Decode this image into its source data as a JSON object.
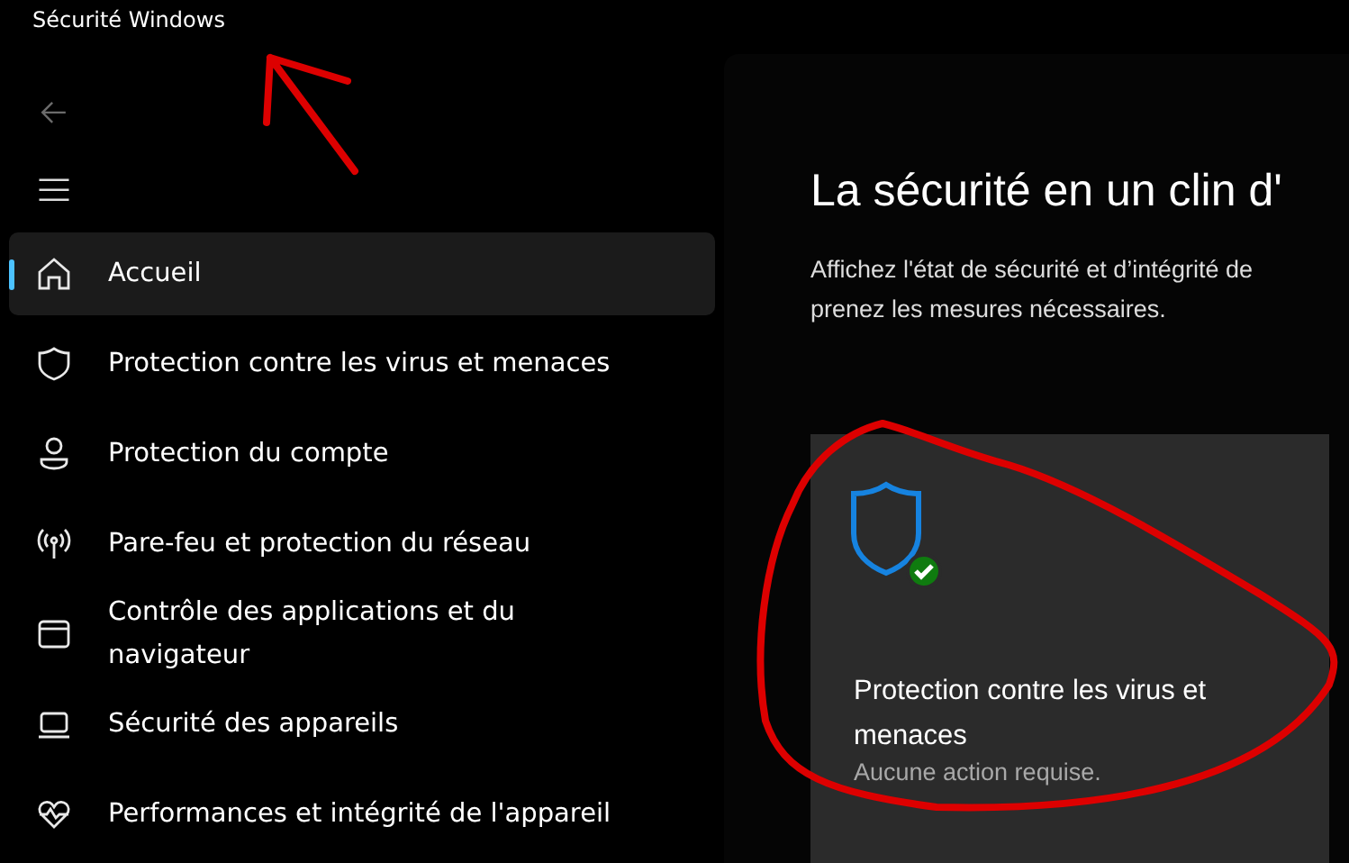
{
  "window": {
    "title": "Sécurité Windows"
  },
  "sidebar": {
    "items": [
      {
        "label": "Accueil",
        "kind": "home",
        "selected": true
      },
      {
        "label": "Protection contre les virus et menaces",
        "kind": "shield",
        "selected": false
      },
      {
        "label": "Protection du compte",
        "kind": "person",
        "selected": false
      },
      {
        "label": "Pare-feu et protection du réseau",
        "kind": "antenna",
        "selected": false
      },
      {
        "label": "Contrôle des applications et du navigateur",
        "kind": "window",
        "selected": false
      },
      {
        "label": "Sécurité des appareils",
        "kind": "laptop",
        "selected": false
      },
      {
        "label": "Performances et intégrité de l'appareil",
        "kind": "heart",
        "selected": false
      }
    ]
  },
  "main": {
    "title": "La sécurité en un clin d'",
    "description": [
      "Affichez l'état de sécurité et d’intégrité de",
      "prenez les mesures nécessaires."
    ],
    "cards": [
      {
        "title": "Protection contre les virus et menaces",
        "status": "Aucune action requise.",
        "ok": true
      }
    ]
  }
}
